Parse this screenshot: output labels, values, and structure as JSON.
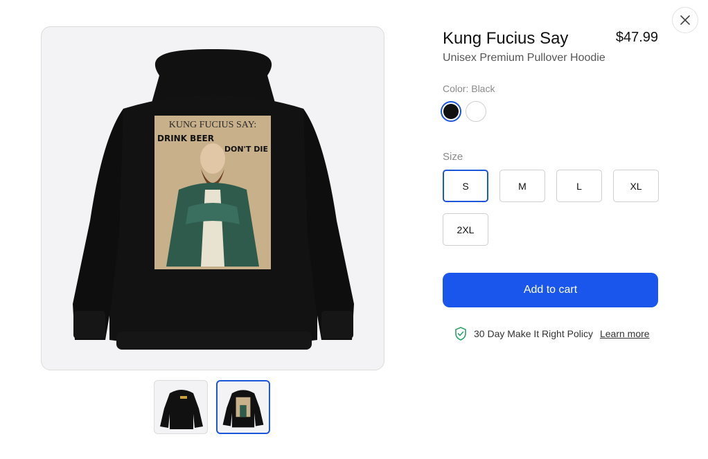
{
  "product": {
    "title": "Kung Fucius Say",
    "price": "$47.99",
    "subtitle": "Unisex Premium Pullover Hoodie",
    "print_text": {
      "header": "KUNG FUCIUS SAY:",
      "left": "DRINK BEER",
      "right": "DON'T DIE"
    }
  },
  "color": {
    "label": "Color: Black",
    "options": [
      {
        "name": "Black",
        "hex": "#111111",
        "selected": true
      },
      {
        "name": "White",
        "hex": "#ffffff",
        "selected": false
      }
    ]
  },
  "size": {
    "label": "Size",
    "options": [
      "S",
      "M",
      "L",
      "XL",
      "2XL"
    ],
    "selected": "S"
  },
  "actions": {
    "add_to_cart": "Add to cart"
  },
  "policy": {
    "text": "30 Day Make It Right Policy",
    "link": "Learn more"
  },
  "colors": {
    "accent": "#1a56eb",
    "selected_border": "#1d56d9"
  }
}
